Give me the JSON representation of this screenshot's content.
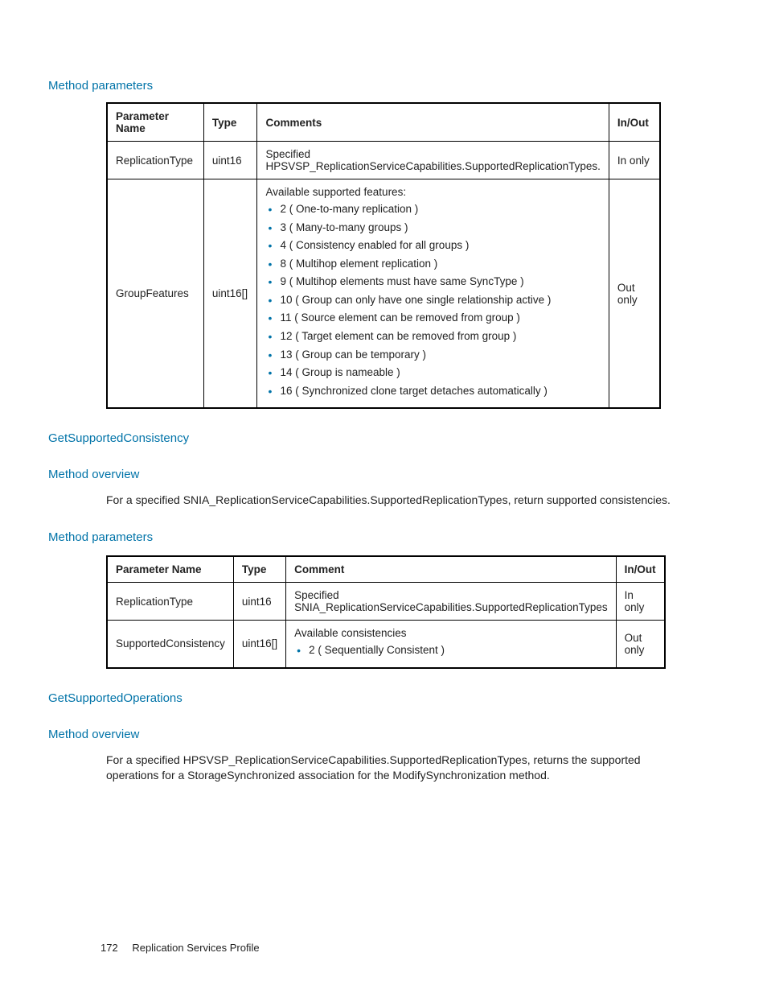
{
  "section1": {
    "heading": "Method parameters",
    "table": {
      "headers": [
        "Parameter Name",
        "Type",
        "Comments",
        "In/Out"
      ],
      "rows": [
        {
          "name": "ReplicationType",
          "type": "uint16",
          "comment_text": "Specified HPSVSP_ReplicationServiceCapabilities.SupportedReplicationTypes.",
          "inout": "In only"
        },
        {
          "name": "GroupFeatures",
          "type": "uint16[]",
          "comment_intro": "Available supported features:",
          "comment_list": [
            "2 ( One-to-many replication )",
            "3 ( Many-to-many groups )",
            "4 ( Consistency enabled for all groups )",
            "8 ( Multihop element replication )",
            "9 ( Multihop elements must have same SyncType )",
            "10 ( Group can only have one single relationship active )",
            "11 ( Source element can be removed from group )",
            "12 ( Target element can be removed from group )",
            "13 ( Group can be temporary )",
            "14 ( Group is nameable )",
            "16 ( Synchronized clone target detaches automatically )"
          ],
          "inout": "Out only"
        }
      ]
    }
  },
  "section2": {
    "title": "GetSupportedConsistency",
    "overview_heading": "Method overview",
    "overview_text": "For a specified SNIA_ReplicationServiceCapabilities.SupportedReplicationTypes, return supported consistencies.",
    "params_heading": "Method parameters",
    "table": {
      "headers": [
        "Parameter Name",
        "Type",
        "Comment",
        "In/Out"
      ],
      "rows": [
        {
          "name": "ReplicationType",
          "type": "uint16",
          "comment_text": "Specified SNIA_ReplicationServiceCapabilities.SupportedReplicationTypes",
          "inout": "In only"
        },
        {
          "name": "SupportedConsistency",
          "type": "uint16[]",
          "comment_intro": "Available consistencies",
          "comment_list": [
            "2 ( Sequentially Consistent )"
          ],
          "inout": "Out only"
        }
      ]
    }
  },
  "section3": {
    "title": "GetSupportedOperations",
    "overview_heading": "Method overview",
    "overview_text": "For a specified HPSVSP_ReplicationServiceCapabilities.SupportedReplicationTypes, returns the supported operations for a StorageSynchronized association for the ModifySynchronization method."
  },
  "footer": {
    "page": "172",
    "title": "Replication Services Profile"
  }
}
